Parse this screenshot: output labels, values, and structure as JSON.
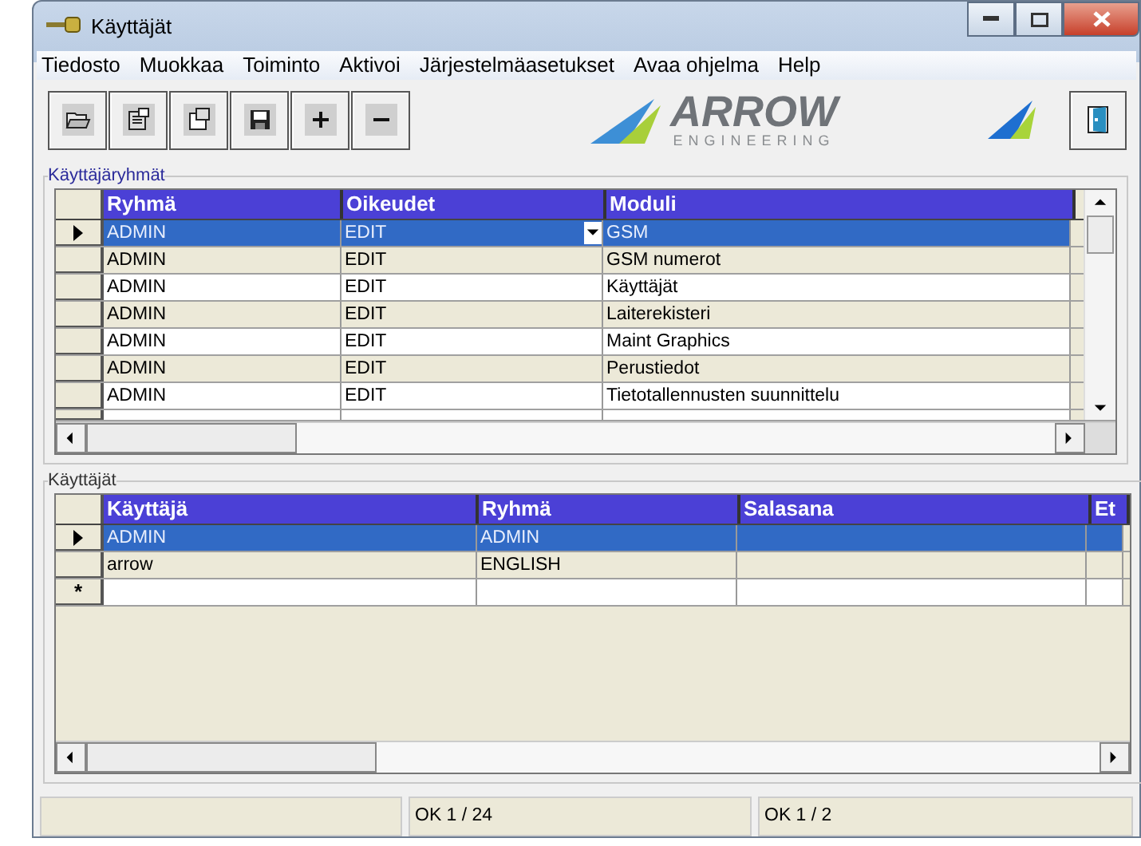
{
  "window": {
    "title": "Käyttäjät"
  },
  "menu": [
    "Tiedosto",
    "Muokkaa",
    "Toiminto",
    "Aktivoi",
    "Järjestelmäasetukset",
    "Avaa ohjelma",
    "Help"
  ],
  "toolbar": [
    {
      "kind": "open"
    },
    {
      "kind": "properties"
    },
    {
      "kind": "copy"
    },
    {
      "kind": "save"
    },
    {
      "kind": "add"
    },
    {
      "kind": "remove"
    }
  ],
  "logo": {
    "name": "ARROW",
    "tagline": "ENGINEERING"
  },
  "user_groups": {
    "title": "Käyttäjäryhmät",
    "columns": [
      "Ryhmä",
      "Oikeudet",
      "Moduli"
    ],
    "rows": [
      {
        "cells": [
          "ADMIN",
          "EDIT",
          "GSM"
        ],
        "selected": true
      },
      {
        "cells": [
          "ADMIN",
          "EDIT",
          "GSM numerot"
        ],
        "selected": false
      },
      {
        "cells": [
          "ADMIN",
          "EDIT",
          "Käyttäjät"
        ],
        "selected": false
      },
      {
        "cells": [
          "ADMIN",
          "EDIT",
          "Laiterekisteri"
        ],
        "selected": false
      },
      {
        "cells": [
          "ADMIN",
          "EDIT",
          "Maint Graphics"
        ],
        "selected": false
      },
      {
        "cells": [
          "ADMIN",
          "EDIT",
          "Perustiedot"
        ],
        "selected": false
      },
      {
        "cells": [
          "ADMIN",
          "EDIT",
          "Tietotallennusten suunnittelu"
        ],
        "selected": false
      }
    ]
  },
  "users": {
    "title": "Käyttäjät",
    "columns": [
      "Käyttäjä",
      "Ryhmä",
      "Salasana",
      "Et"
    ],
    "rows": [
      {
        "cells": [
          "ADMIN",
          "ADMIN",
          "",
          ""
        ],
        "selected": true
      },
      {
        "cells": [
          "arrow",
          "ENGLISH",
          "",
          ""
        ],
        "selected": false
      }
    ],
    "new_row_marker": "*"
  },
  "status_bar": {
    "groups_position": "OK 1 / 24",
    "users_position": "OK 1 / 2"
  }
}
